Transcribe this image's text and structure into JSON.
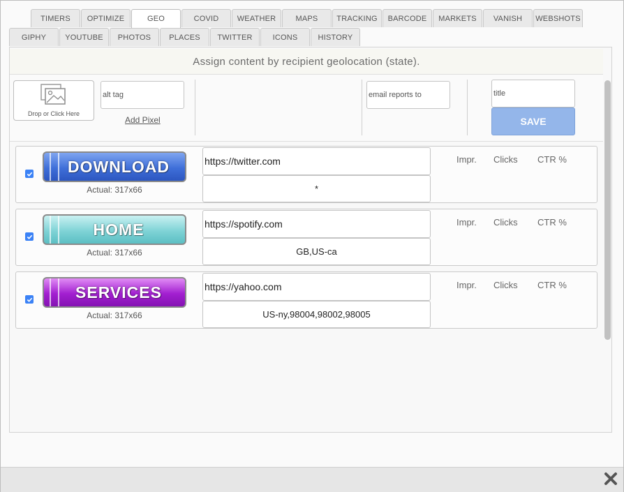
{
  "tabs_row1": [
    "TIMERS",
    "OPTIMIZE",
    "GEO",
    "COVID",
    "WEATHER",
    "MAPS",
    "TRACKING",
    "BARCODE",
    "MARKETS",
    "VANISH",
    "WEBSHOTS"
  ],
  "tabs_row2": [
    "GIPHY",
    "YOUTUBE",
    "PHOTOS",
    "PLACES",
    "TWITTER",
    "ICONS",
    "HISTORY"
  ],
  "active_tab": "GEO",
  "banner": "Assign content by recipient geolocation (state).",
  "toolbar": {
    "drop_label": "Drop or Click Here",
    "alt_placeholder": "alt tag",
    "add_pixel": "Add Pixel",
    "email_placeholder": "email reports to",
    "title_placeholder": "title",
    "save": "SAVE",
    "save_color": "#94b6ea"
  },
  "rows": [
    {
      "checked": true,
      "button_text": "DOWNLOAD",
      "button_color": "#3f6fd9",
      "actual": "Actual: 317x66",
      "url": "https://twitter.com",
      "geo": "*",
      "impr": "Impr.",
      "clicks": "Clicks",
      "ctr": "CTR %"
    },
    {
      "checked": true,
      "button_text": "HOME",
      "button_color": "#7fd3d6",
      "actual": "Actual: 317x66",
      "url": "https://spotify.com",
      "geo": "GB,US-ca",
      "impr": "Impr.",
      "clicks": "Clicks",
      "ctr": "CTR %"
    },
    {
      "checked": true,
      "button_text": "SERVICES",
      "button_color": "#a21fd0",
      "actual": "Actual: 317x66",
      "url": "https://yahoo.com",
      "geo": "US-ny,98004,98002,98005",
      "impr": "Impr.",
      "clicks": "Clicks",
      "ctr": "CTR %"
    }
  ],
  "icons": {
    "close": "close-icon",
    "image": "image-icon",
    "check": "checkmark-icon"
  }
}
